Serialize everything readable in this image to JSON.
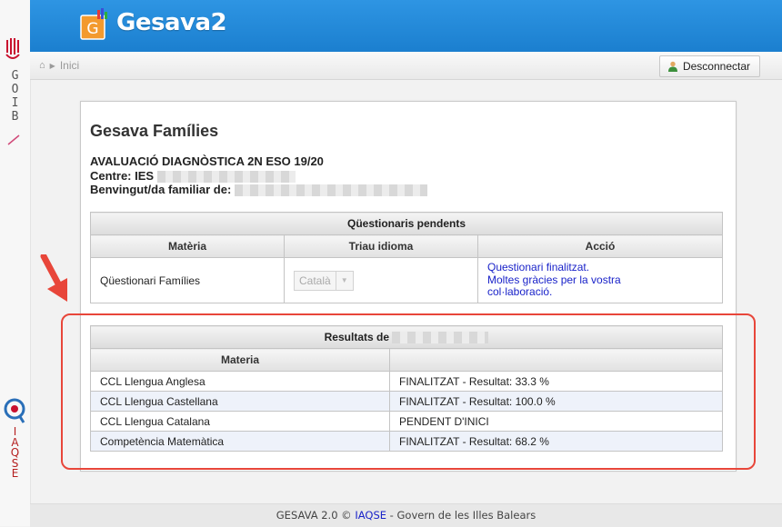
{
  "sidebar": {
    "goib_letters": [
      "G",
      "O",
      "I",
      "B"
    ],
    "iaqse_letters": [
      "I",
      "A",
      "Q",
      "S",
      "E"
    ]
  },
  "header": {
    "logo_letter": "G",
    "app_title": "Gesava2"
  },
  "navbar": {
    "breadcrumb": "Inici",
    "logout_label": "Desconnectar"
  },
  "panel": {
    "title": "Gesava Famílies",
    "exam_title": "AVALUACIÓ DIAGNÒSTICA 2N ESO 19/20",
    "centre_label": "Centre: IES",
    "welcome_label": "Benvingut/da familiar de:"
  },
  "questionnaires": {
    "caption": "Qüestionaris pendents",
    "headers": [
      "Matèria",
      "Triau idioma",
      "Acció"
    ],
    "row": {
      "subject": "Qüestionari Famílies",
      "language": "Català",
      "action_lines": [
        "Questionari finalitzat.",
        "Moltes gràcies per la vostra",
        "col·laboració."
      ]
    }
  },
  "results": {
    "caption": "Resultats de",
    "headers": [
      "Materia",
      ""
    ],
    "rows": [
      {
        "subject": "CCL Llengua Anglesa",
        "status": "FINALITZAT - Resultat: 33.3 %"
      },
      {
        "subject": "CCL Llengua Castellana",
        "status": "FINALITZAT - Resultat: 100.0 %"
      },
      {
        "subject": "CCL Llengua Catalana",
        "status": "PENDENT D'INICI"
      },
      {
        "subject": "Competència Matemàtica",
        "status": "FINALITZAT - Resultat: 68.2 %"
      }
    ]
  },
  "footer": {
    "prefix": "GESAVA 2.0 © ",
    "link": "IAQSE",
    "suffix": " - Govern de les Illes Balears"
  },
  "colors": {
    "header_blue": "#1b7fcf",
    "link_blue": "#1a23c9",
    "highlight_red": "#e8463a",
    "iaqse_red": "#b52020"
  }
}
